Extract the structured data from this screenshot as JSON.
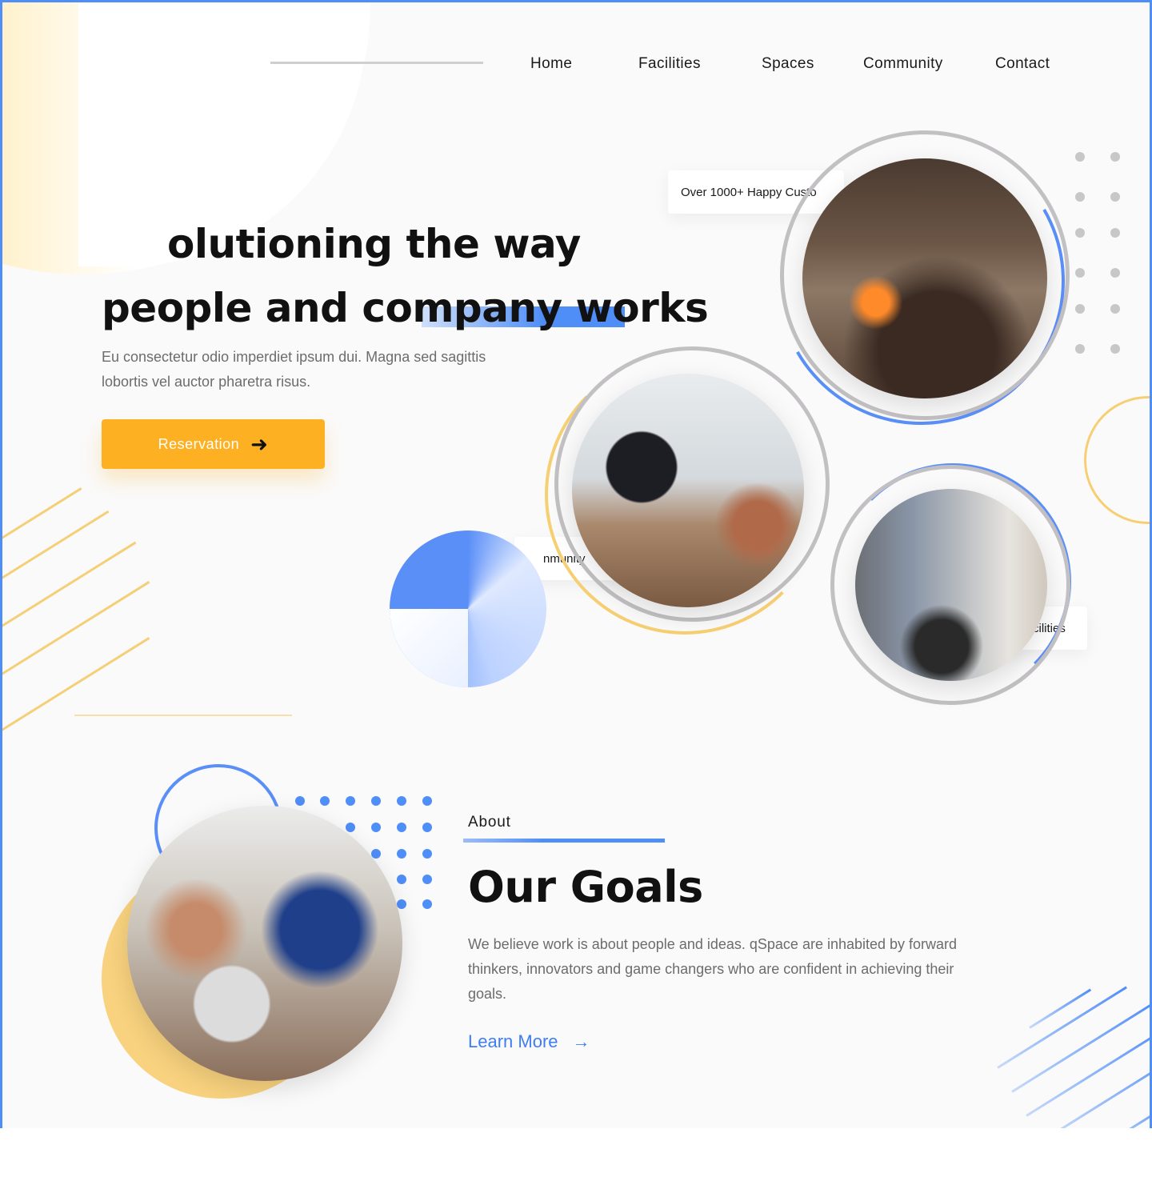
{
  "nav": {
    "items": [
      {
        "label": "Home"
      },
      {
        "label": "Facilities"
      },
      {
        "label": "Spaces"
      },
      {
        "label": "Community"
      },
      {
        "label": "Contact"
      }
    ]
  },
  "hero": {
    "title_line1": "olutioning the way",
    "title_line2": "people and company works",
    "subtitle": "Eu consectetur odio imperdiet ipsum dui. Magna sed sagittis lobortis vel auctor pharetra risus.",
    "button_label": "Reservation",
    "button_icon": "arrow-right-icon"
  },
  "badges": {
    "customers": "Over 1000+ Happy Custo",
    "community": "nmunity",
    "facilities": "cilities"
  },
  "photos": {
    "lounge": "lounge-photo",
    "meeting": "video-meeting-photo",
    "living": "living-room-photo",
    "team": "team-laptop-photo"
  },
  "about": {
    "label": "About",
    "title": "Our Goals",
    "text": "We believe work is about people and ideas. qSpace are inhabited by forward thinkers, innovators and game changers who are confident in achieving their goals.",
    "link_label": "Learn More",
    "link_icon": "arrow-right-icon"
  },
  "colors": {
    "accent_blue": "#4f8ef7",
    "accent_yellow": "#fdb022",
    "decor_yellow": "#f6cf73",
    "background": "#fafafa"
  }
}
